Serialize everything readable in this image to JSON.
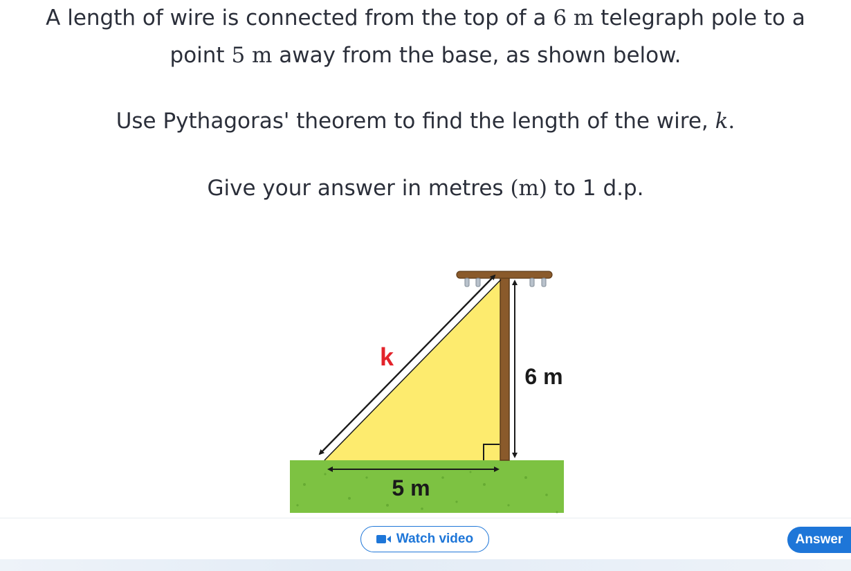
{
  "question": {
    "line1": {
      "a": "A length of wire is connected from the top of a ",
      "m1": "6",
      "m1u": "m",
      "b": " telegraph pole to a"
    },
    "line2": {
      "a": "point ",
      "m1": "5",
      "m1u": "m",
      "b": " away from the base, as shown below."
    },
    "line3": {
      "a": "Use Pythagoras' theorem to find the length of the wire, ",
      "var": "k",
      "b": "."
    },
    "line4": {
      "a": "Give your answer in metres ",
      "unit": "(m)",
      "b": " to 1 d.p."
    }
  },
  "diagram": {
    "hyp_label": "k",
    "vert_label": "6 m",
    "base_label": "5 m",
    "colors": {
      "triangle": "#fdeb6e",
      "grass": "#7dc242",
      "pole": "#8a5a2b",
      "k_label": "#e3232b"
    }
  },
  "footer": {
    "watch_video_label": "Watch video",
    "answer_label": "Answer",
    "camera_icon": "video-camera-icon"
  }
}
